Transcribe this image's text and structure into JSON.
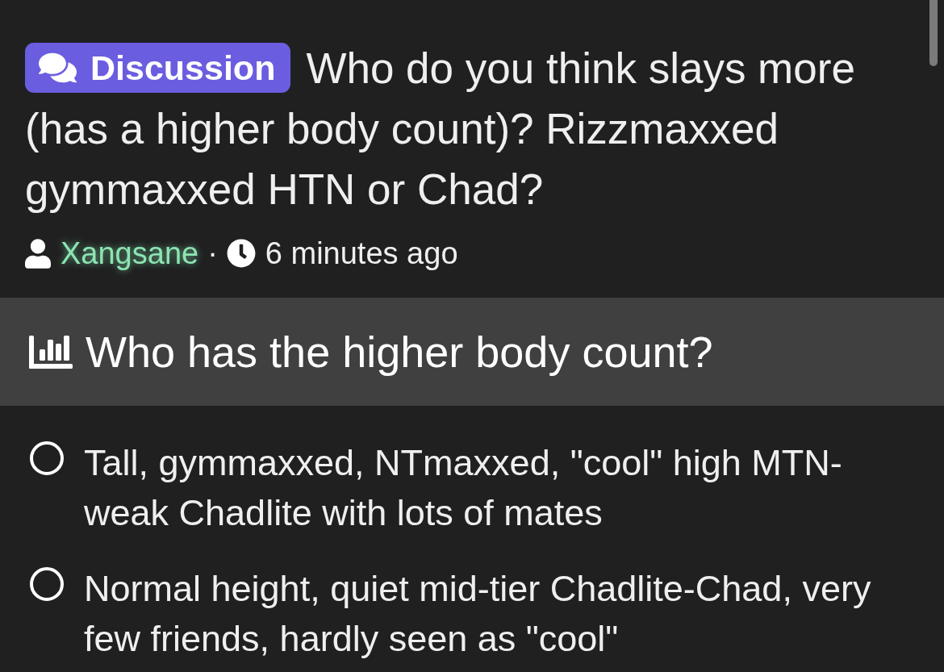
{
  "post": {
    "tag": {
      "label": "Discussion"
    },
    "title": "Who do you think slays more (has a higher body count)? Rizzmaxxed gymmaxxed HTN or Chad?",
    "author": "Xangsane",
    "separator": "·",
    "time": "6 minutes ago"
  },
  "poll": {
    "question": "Who has the higher body count?",
    "options": [
      {
        "label": "Tall, gymmaxxed, NTmaxxed, \"cool\" high MTN-weak Chadlite with lots of mates",
        "selected": false
      },
      {
        "label": "Normal height, quiet mid-tier Chadlite-Chad, very few friends, hardly seen as \"cool\"",
        "selected": false
      }
    ]
  }
}
